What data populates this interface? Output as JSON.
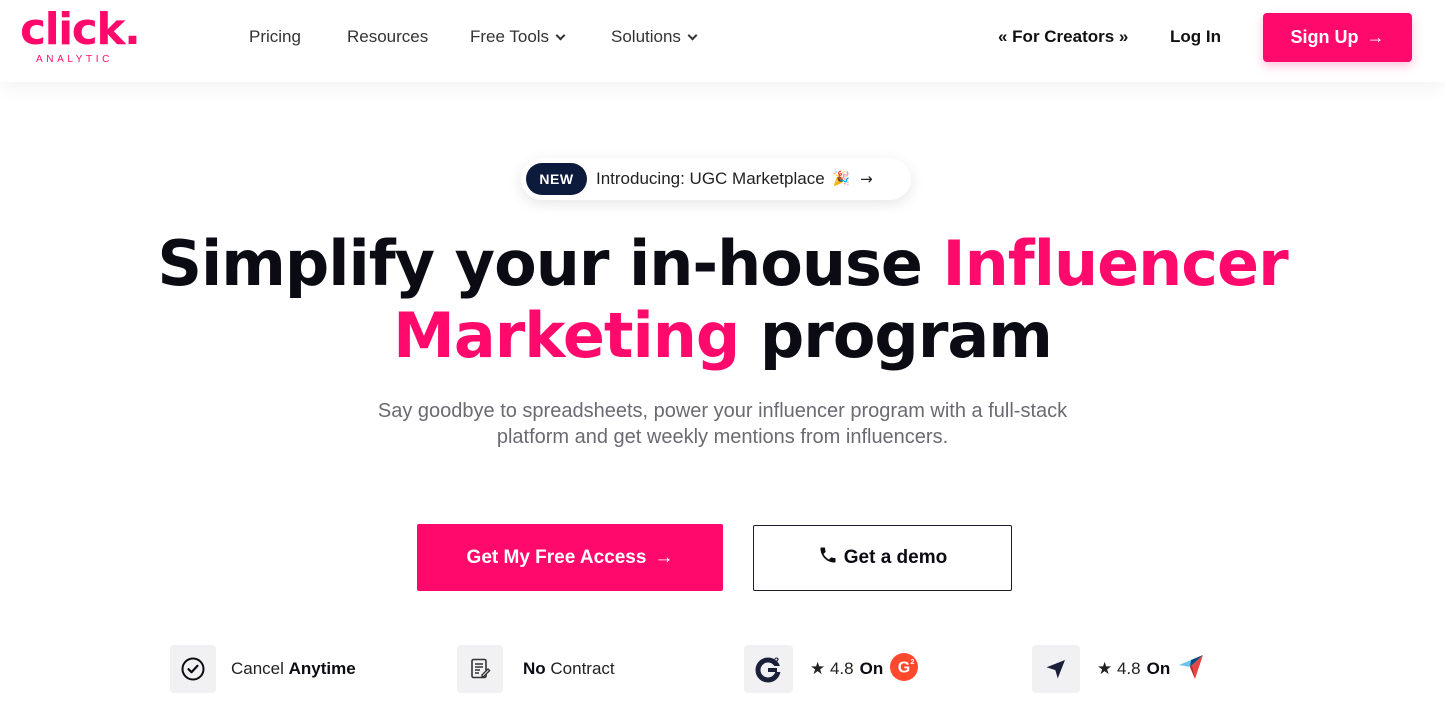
{
  "brand": {
    "name": "click.",
    "tagline": "ANALYTIC",
    "accent": "#ff0a6c",
    "dark": "#0c1a3b"
  },
  "nav": {
    "items": [
      {
        "label": "Pricing",
        "dropdown": false
      },
      {
        "label": "Resources",
        "dropdown": false
      },
      {
        "label": "Free Tools",
        "dropdown": true
      },
      {
        "label": "Solutions",
        "dropdown": true
      }
    ],
    "for_creators": "« For Creators »",
    "login": "Log In",
    "signup": "Sign Up",
    "signup_arrow": "→"
  },
  "announcement": {
    "badge": "NEW",
    "text": "Introducing: UGC Marketplace",
    "emoji": "🎉",
    "arrow": "→"
  },
  "hero": {
    "headline_part1": "Simplify your in-house ",
    "headline_highlight1": "Influencer",
    "headline_highlight2": "Marketing",
    "headline_part2": " program",
    "subtext_line1": "Say goodbye to spreadsheets, power your influencer program with a full-stack",
    "subtext_line2": "platform and get weekly mentions from influencers."
  },
  "cta": {
    "primary": "Get My Free Access",
    "primary_arrow": "→",
    "secondary": "Get a demo",
    "secondary_icon": "phone-icon"
  },
  "features": [
    {
      "icon": "check-circle-icon",
      "text_regular": "Cancel ",
      "text_bold": "Anytime"
    },
    {
      "icon": "document-edit-icon",
      "text_bold": "No",
      "text_regular": " Contract"
    },
    {
      "icon": "g2-icon",
      "rating": "★ 4.8",
      "on": "On",
      "logo": "g2-logo-icon"
    },
    {
      "icon": "capterra-icon",
      "rating": "★ 4.8",
      "on": "On",
      "logo": "capterra-logo-icon"
    }
  ]
}
